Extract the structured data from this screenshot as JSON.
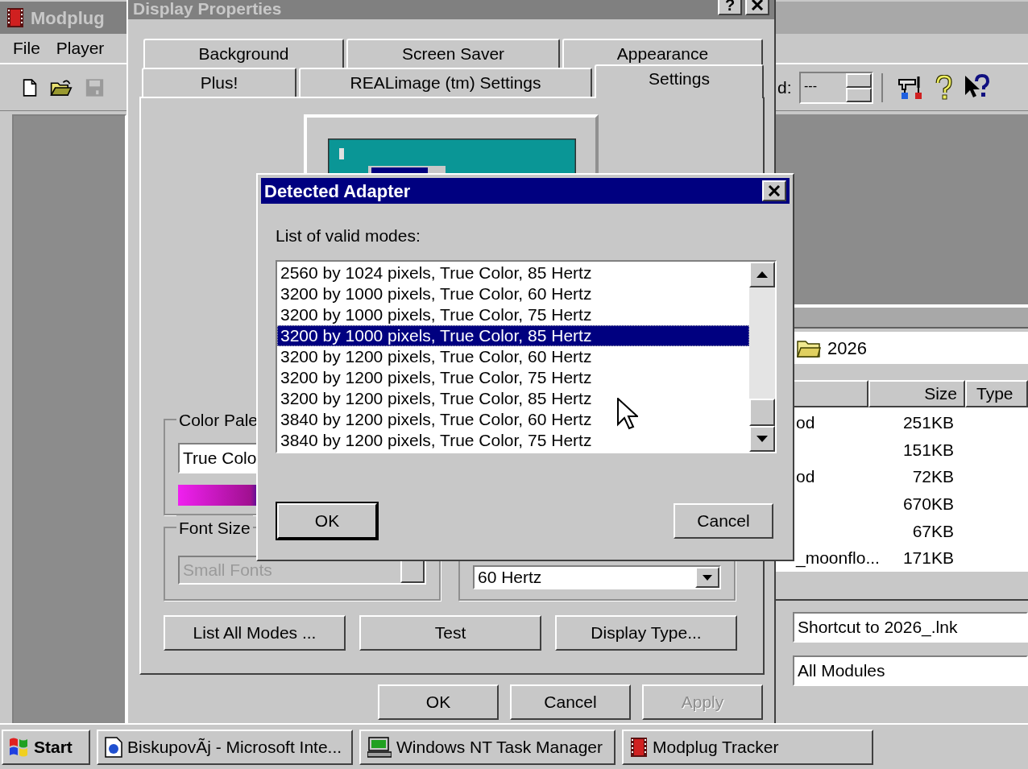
{
  "modplug": {
    "title": "Modplug",
    "menu": [
      "File",
      "Player"
    ],
    "toolbar_label": "d:",
    "spin_value": "---",
    "folder": "2026",
    "file_list": {
      "columns": [
        "Size",
        "Type"
      ],
      "rows": [
        {
          "name": "od",
          "size": "251KB"
        },
        {
          "size": "151KB"
        },
        {
          "name": "od",
          "size": "72KB"
        },
        {
          "size": "670KB"
        },
        {
          "size": "67KB"
        },
        {
          "name": "_moonflo...",
          "size": "171KB"
        }
      ]
    },
    "fields": [
      "Shortcut to 2026_.lnk",
      "All Modules"
    ]
  },
  "display_properties": {
    "title": "Display Properties",
    "help_button": "?",
    "tab_rows": [
      [
        {
          "label": "Background",
          "selected": false
        },
        {
          "label": "Screen Saver",
          "selected": false
        },
        {
          "label": "Appearance",
          "selected": false
        }
      ],
      [
        {
          "label": "Plus!",
          "selected": false
        },
        {
          "label": "REALimage (tm) Settings",
          "selected": false
        },
        {
          "label": "Settings",
          "selected": true
        }
      ]
    ],
    "color_palette": {
      "label": "Color Pale",
      "value": "True Colo"
    },
    "font_size": {
      "label": "Font Size",
      "value": "Small Fonts",
      "disabled": true
    },
    "refresh_rate": {
      "value": "60 Hertz"
    },
    "buttons": [
      "List All Modes ...",
      "Test",
      "Display Type..."
    ],
    "footer_buttons": [
      {
        "label": "OK",
        "disabled": false
      },
      {
        "label": "Cancel",
        "disabled": false
      },
      {
        "label": "Apply",
        "disabled": true
      }
    ]
  },
  "dialog": {
    "title": "Detected Adapter",
    "prompt": "List of valid modes:",
    "modes": [
      {
        "label": "2560 by 1024 pixels, True Color, 85 Hertz",
        "selected": false
      },
      {
        "label": "3200 by 1000 pixels, True Color, 60 Hertz",
        "selected": false
      },
      {
        "label": "3200 by 1000 pixels, True Color, 75 Hertz",
        "selected": false
      },
      {
        "label": "3200 by 1000 pixels, True Color, 85 Hertz",
        "selected": true
      },
      {
        "label": "3200 by 1200 pixels, True Color, 60 Hertz",
        "selected": false
      },
      {
        "label": "3200 by 1200 pixels, True Color, 75 Hertz",
        "selected": false
      },
      {
        "label": "3200 by 1200 pixels, True Color, 85 Hertz",
        "selected": false
      },
      {
        "label": "3840 by 1200 pixels, True Color, 60 Hertz",
        "selected": false
      },
      {
        "label": "3840 by 1200 pixels, True Color, 75 Hertz",
        "selected": false
      }
    ],
    "buttons": [
      {
        "label": "OK",
        "default": true
      },
      {
        "label": "Cancel",
        "default": false
      }
    ]
  },
  "taskbar": {
    "start": "Start",
    "tasks": [
      {
        "label": "BiskupovÃj - Microsoft Inte...",
        "selected": false
      },
      {
        "label": "Windows NT Task Manager",
        "selected": false
      },
      {
        "label": "Modplug Tracker",
        "selected": false
      }
    ]
  }
}
